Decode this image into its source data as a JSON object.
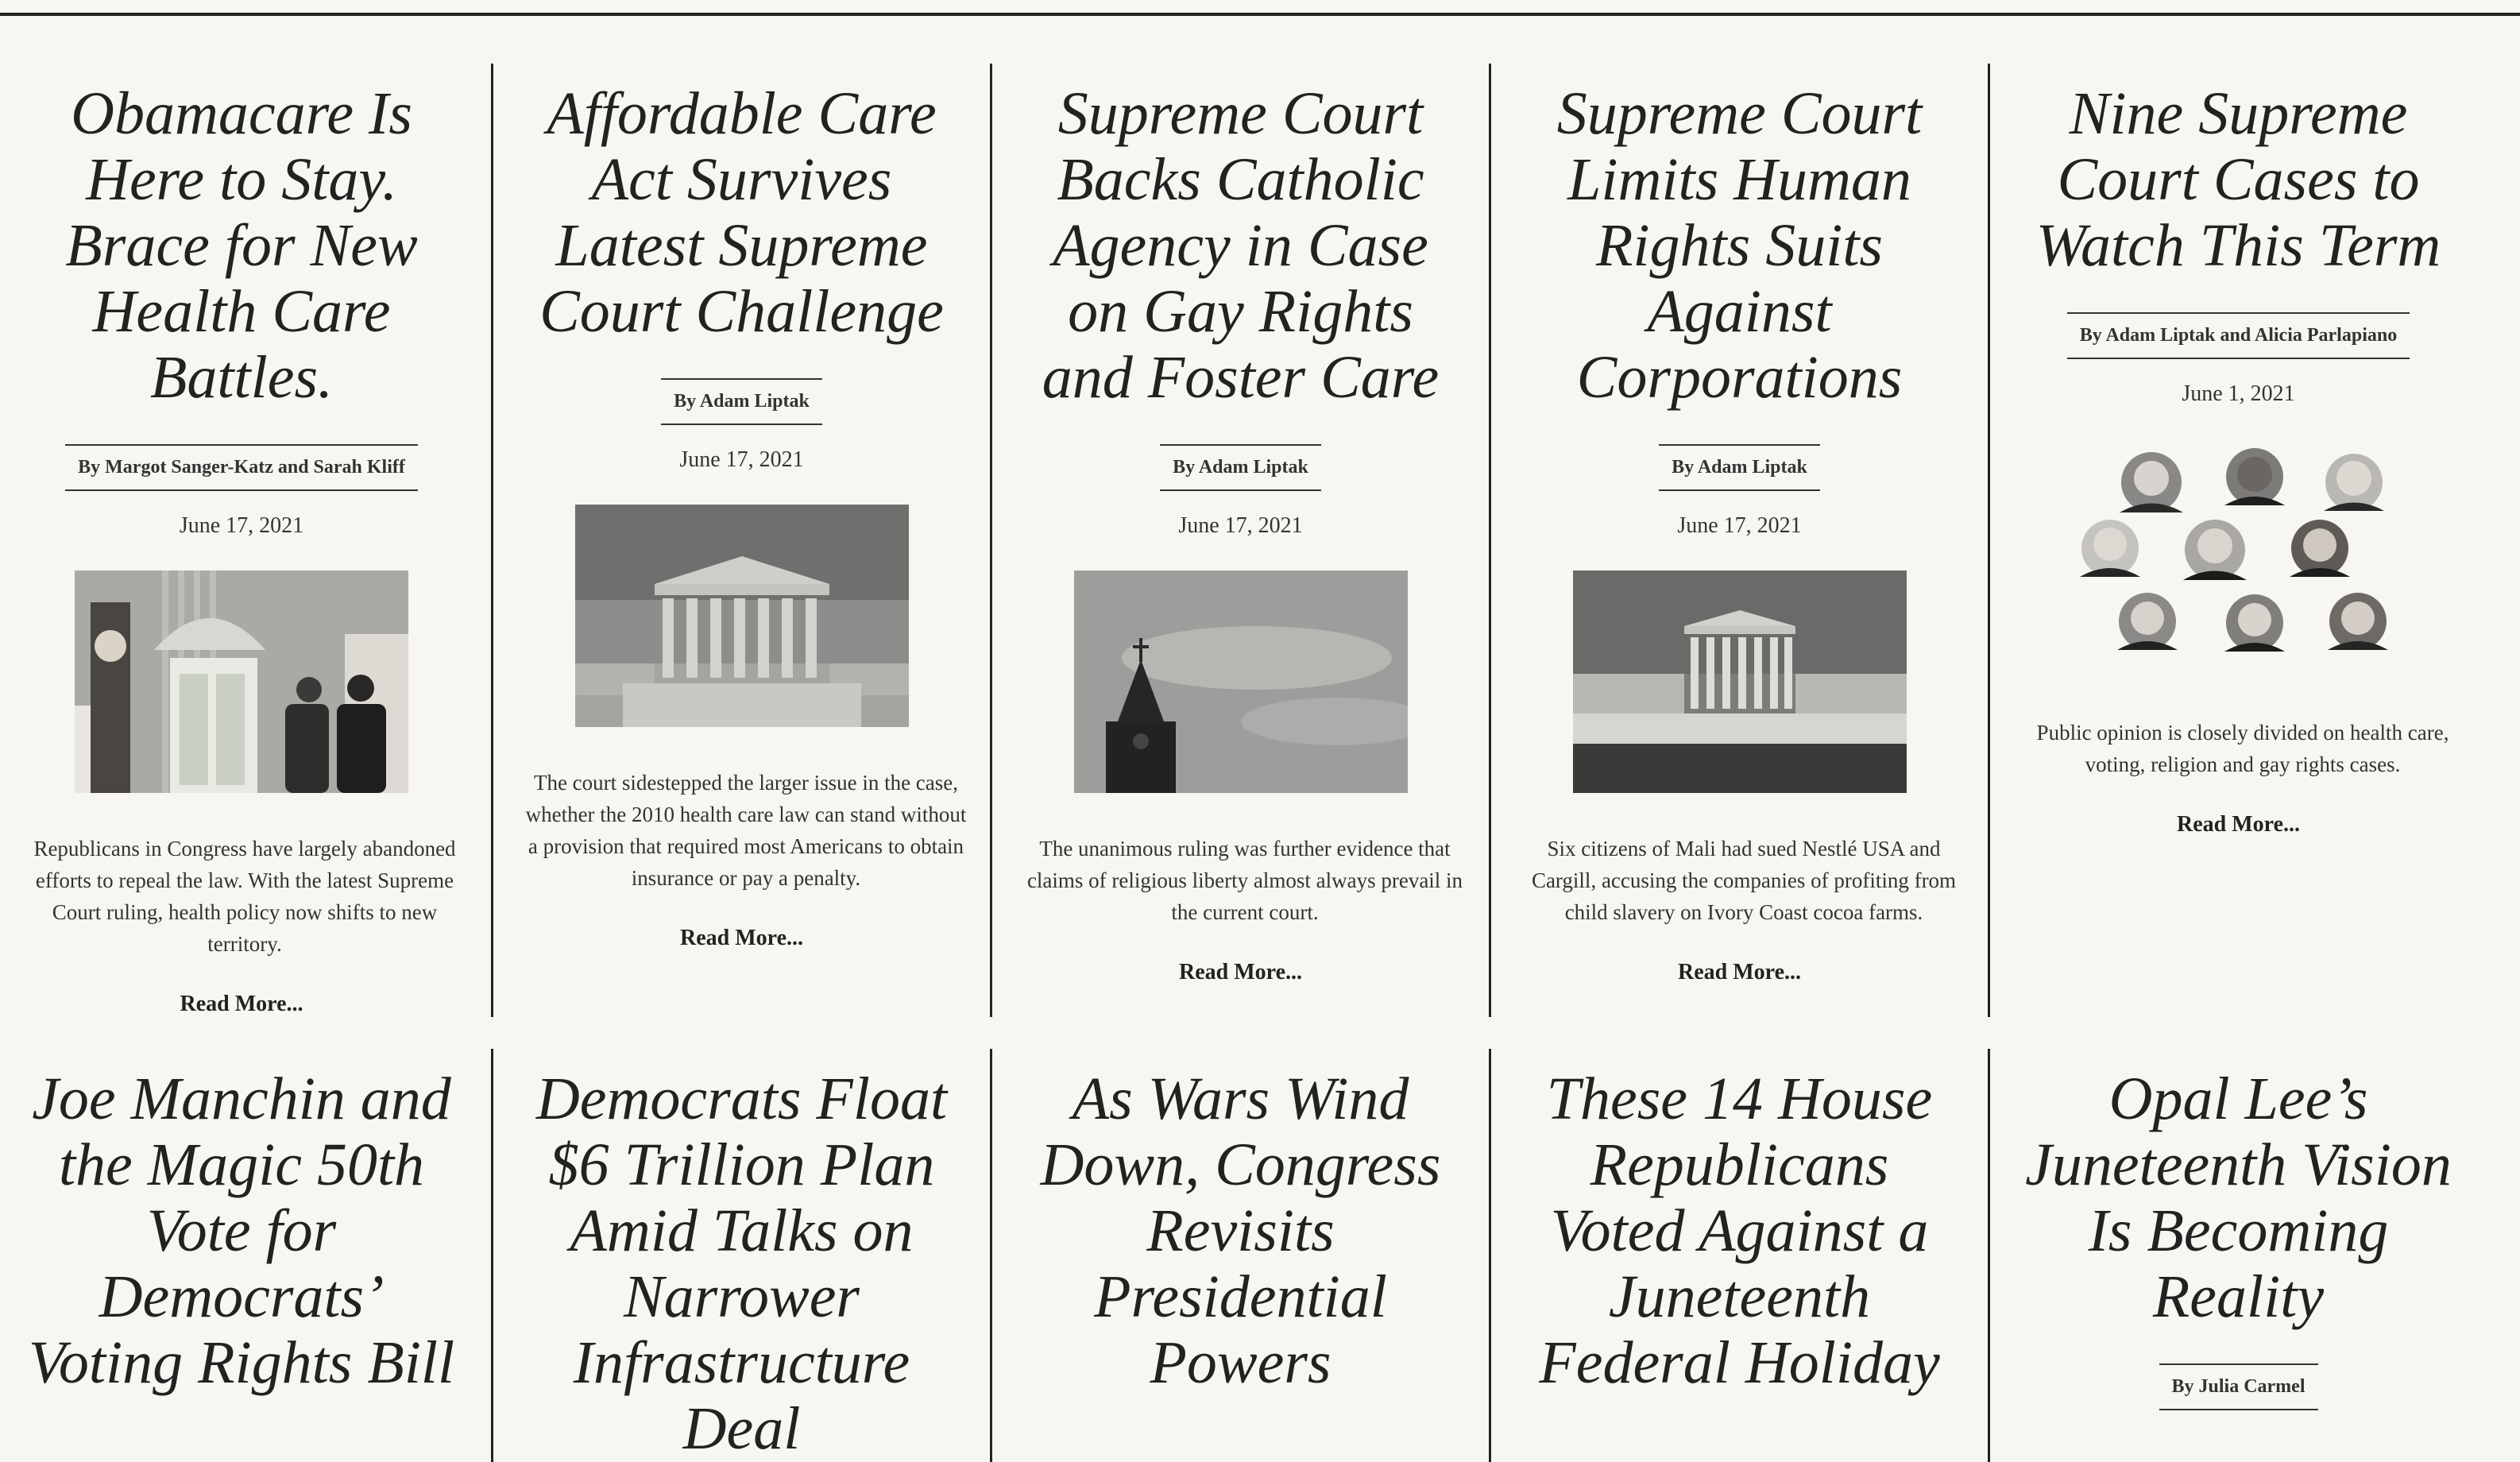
{
  "articles": [
    {
      "headline": "Obamacare Is Here to Stay. Brace for New Health Care Battles.",
      "byline": "By Margot Sanger-Katz and Sarah Kliff",
      "date": "June 17, 2021",
      "summary": "Republicans in Congress have largely abandoned efforts to repeal the law. With the latest Supreme Court ruling, health policy now shifts to new territory.",
      "read_more": "Read More...",
      "image": "oval-office-photo"
    },
    {
      "headline": "Affordable Care Act Survives Latest Supreme Court Challenge",
      "byline": "By Adam Liptak",
      "date": "June 17, 2021",
      "summary": "The court sidestepped the larger issue in the case, whether the 2010 health care law can stand without a provision that required most Americans to obtain insurance or pay a penalty.",
      "read_more": "Read More...",
      "image": "supreme-court-building-photo"
    },
    {
      "headline": "Supreme Court Backs Catholic Agency in Case on Gay Rights and Foster Care",
      "byline": "By Adam Liptak",
      "date": "June 17, 2021",
      "summary": "The unanimous ruling was further evidence that claims of religious liberty almost always prevail in the current court.",
      "read_more": "Read More...",
      "image": "church-steeple-photo"
    },
    {
      "headline": "Supreme Court Limits Human Rights Suits Against Corporations",
      "byline": "By Adam Liptak",
      "date": "June 17, 2021",
      "summary": "Six citizens of Mali had sued Nestlé USA and Cargill, accusing the companies of profiting from child slavery on Ivory Coast cocoa farms.",
      "read_more": "Read More...",
      "image": "supreme-court-plaza-photo"
    },
    {
      "headline": "Nine Supreme Court Cases to Watch This Term",
      "byline": "By Adam Liptak and Alicia Parlapiano",
      "date": "June 1, 2021",
      "summary": "Public opinion is closely divided on health care, voting, religion and gay rights cases.",
      "read_more": "Read More...",
      "image": "justices-portraits"
    }
  ],
  "articles_row2": [
    {
      "headline": "Joe Manchin and the Magic 50th Vote for Democrats’ Voting Rights Bill"
    },
    {
      "headline": "Democrats Float $6 Trillion Plan Amid Talks on Narrower Infrastructure Deal"
    },
    {
      "headline": "As Wars Wind Down, Congress Revisits Presidential Powers"
    },
    {
      "headline": "These 14 House Republicans Voted Against a Juneteenth Federal Holiday"
    },
    {
      "headline": "Opal Lee’s Juneteenth Vision Is Becoming Reality",
      "byline": "By Julia Carmel"
    }
  ]
}
